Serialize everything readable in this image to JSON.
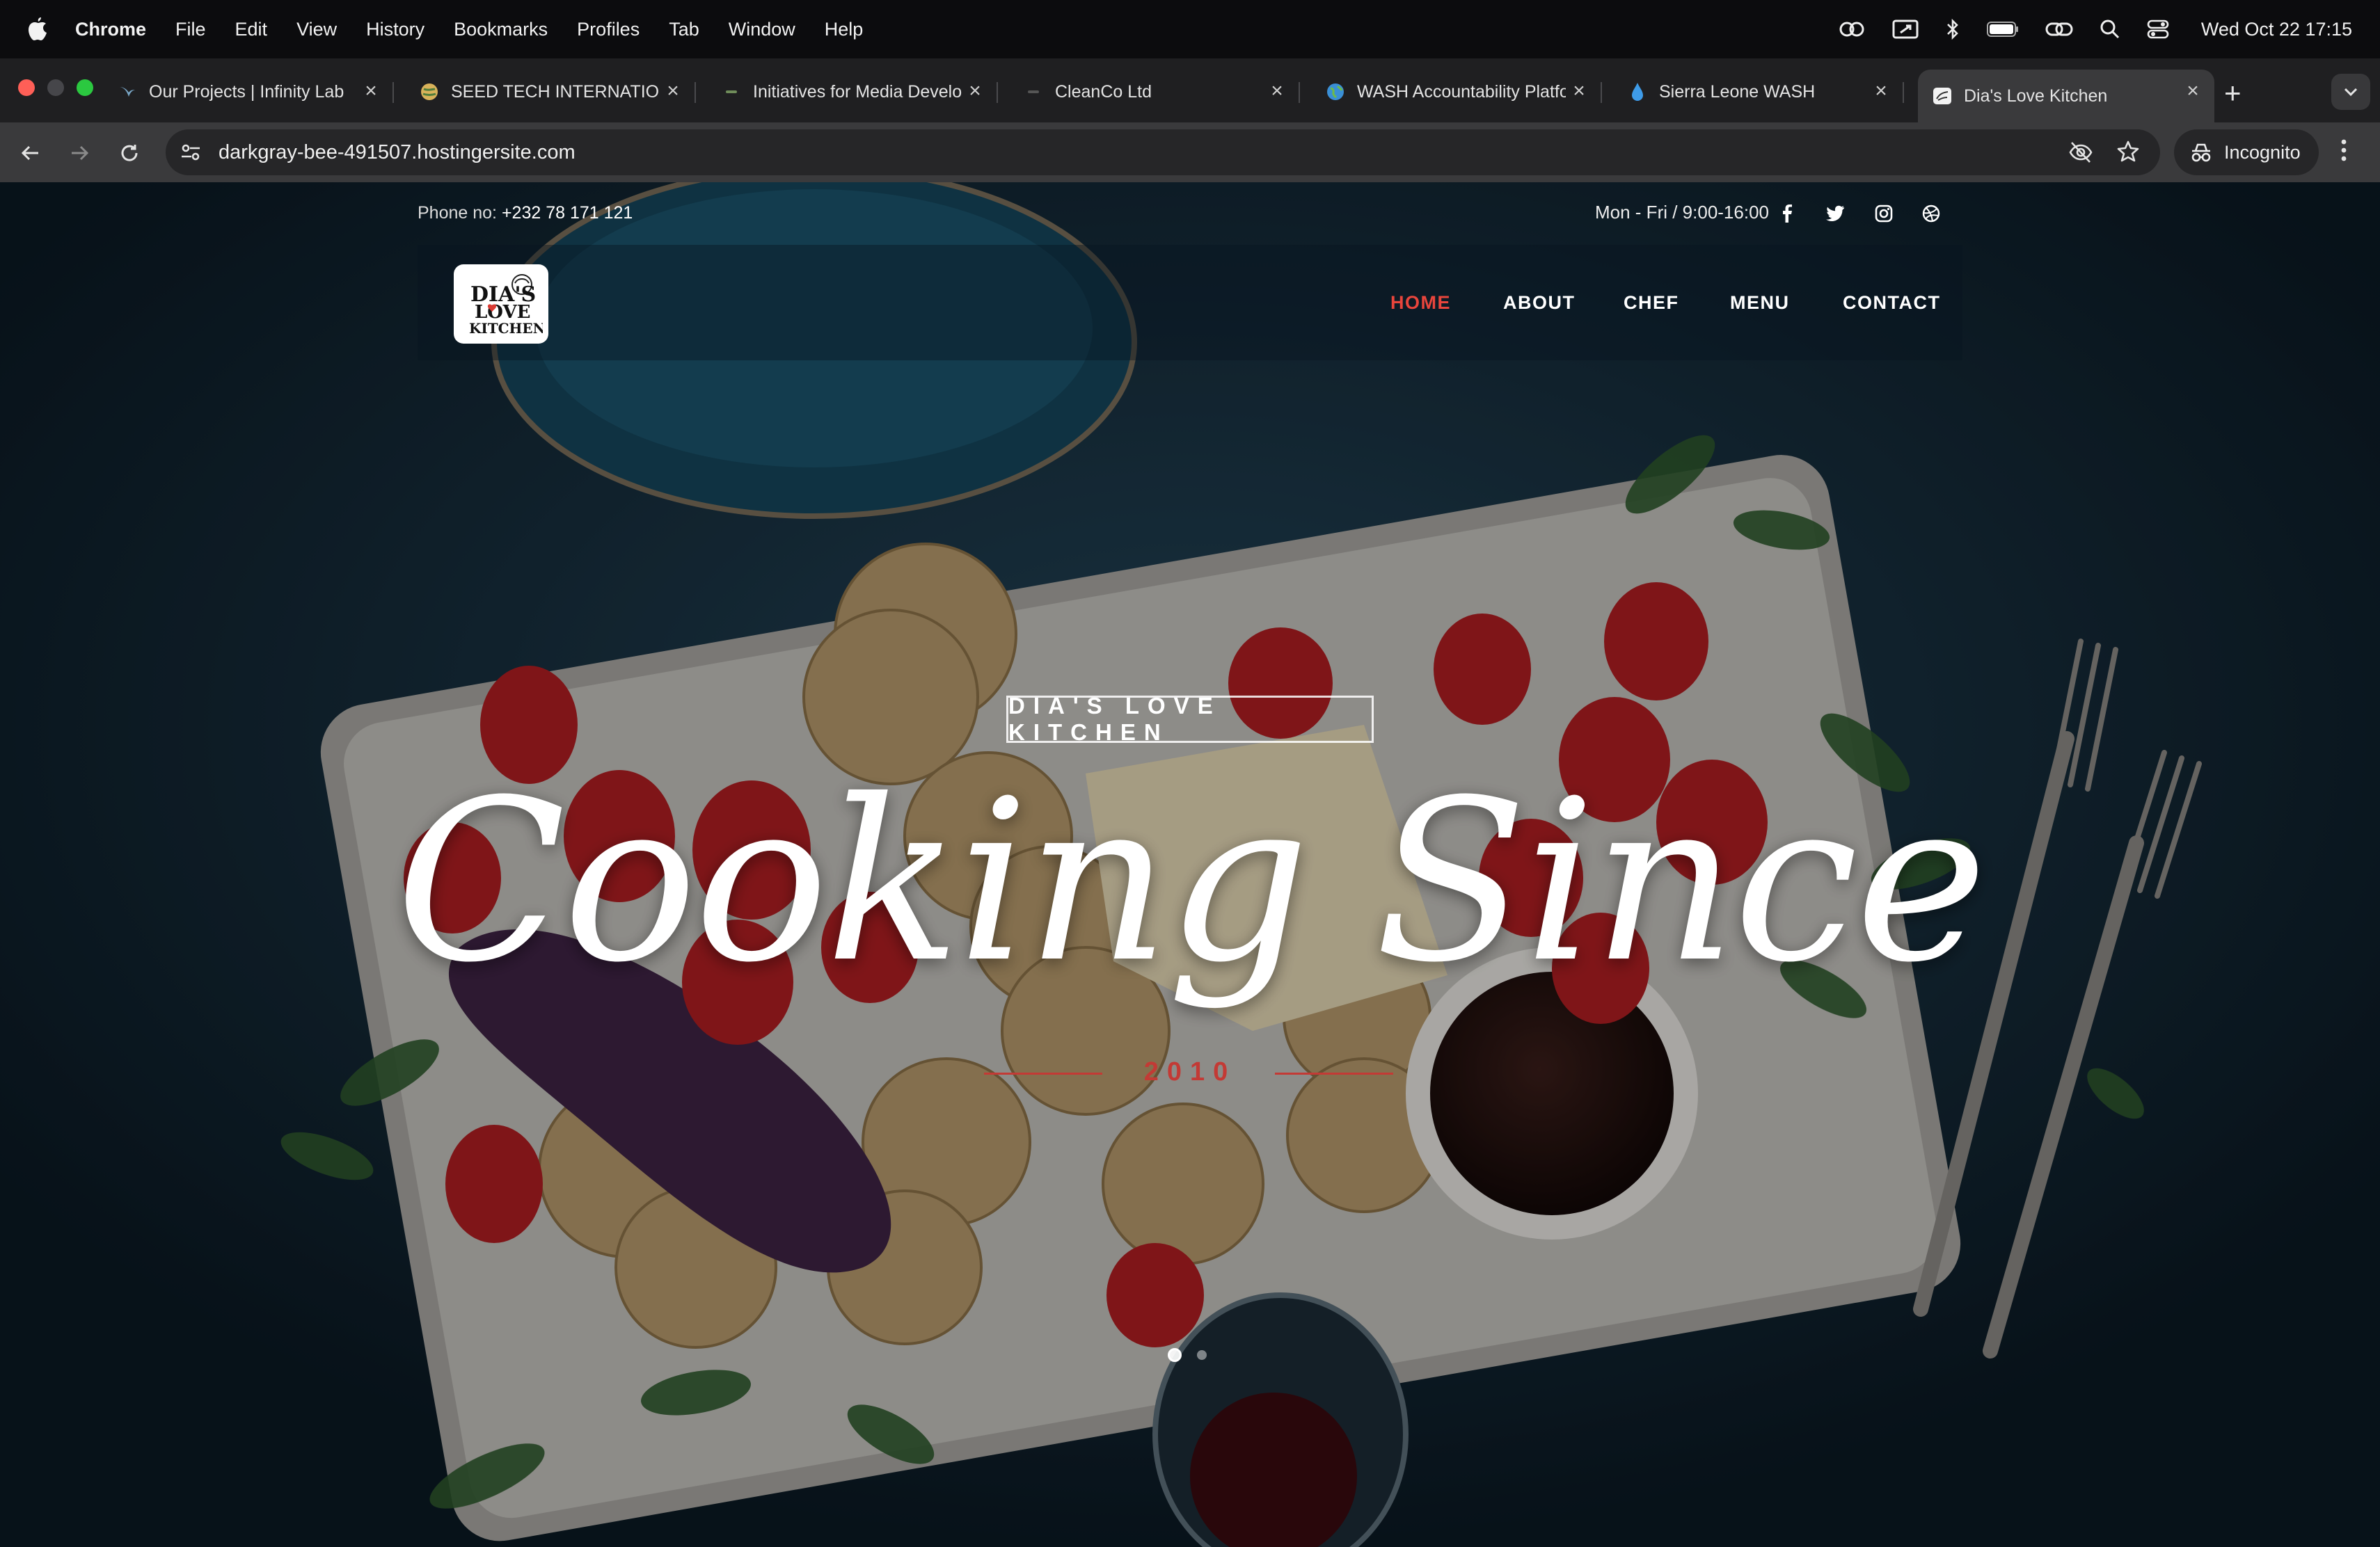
{
  "menubar": {
    "app": "Chrome",
    "items": [
      "File",
      "Edit",
      "View",
      "History",
      "Bookmarks",
      "Profiles",
      "Tab",
      "Window",
      "Help"
    ],
    "clock": "Wed Oct 22  17:15"
  },
  "tabs": [
    {
      "title": "Our Projects | Infinity Lab",
      "favicon": "bird-icon"
    },
    {
      "title": "SEED TECH INTERNATIONAL",
      "favicon": "globe-icon"
    },
    {
      "title": "Initiatives for Media Development",
      "favicon": "dash-icon"
    },
    {
      "title": "CleanCo Ltd",
      "favicon": "dash-icon"
    },
    {
      "title": "WASH Accountability Platform",
      "favicon": "earth-icon"
    },
    {
      "title": "Sierra Leone WASH",
      "favicon": "water-drop-icon"
    },
    {
      "title": "Dia's Love Kitchen",
      "favicon": "site-logo-icon"
    }
  ],
  "address": {
    "url": "darkgray-bee-491507.hostingersite.com",
    "incognito_label": "Incognito"
  },
  "site": {
    "phone_label": "Phone no:",
    "phone": "+232 78 171 121",
    "hours": "Mon - Fri / 9:00-16:00",
    "social": [
      "facebook-icon",
      "twitter-icon",
      "instagram-icon",
      "dribbble-icon"
    ],
    "logo_text": {
      "line1": "DIA'S",
      "line2": "LOVE",
      "line3": "KITCHEN"
    },
    "nav": [
      "HOME",
      "ABOUT",
      "CHEF",
      "MENU",
      "CONTACT"
    ],
    "hero": {
      "kicker": "DIA'S LOVE KITCHEN",
      "headline": "Cooking Since",
      "year": "2010"
    },
    "slider": {
      "slides": 2,
      "active": 1
    }
  },
  "colors": {
    "accent": "#e8453c",
    "year": "#c33a35",
    "background": "#13293a"
  }
}
